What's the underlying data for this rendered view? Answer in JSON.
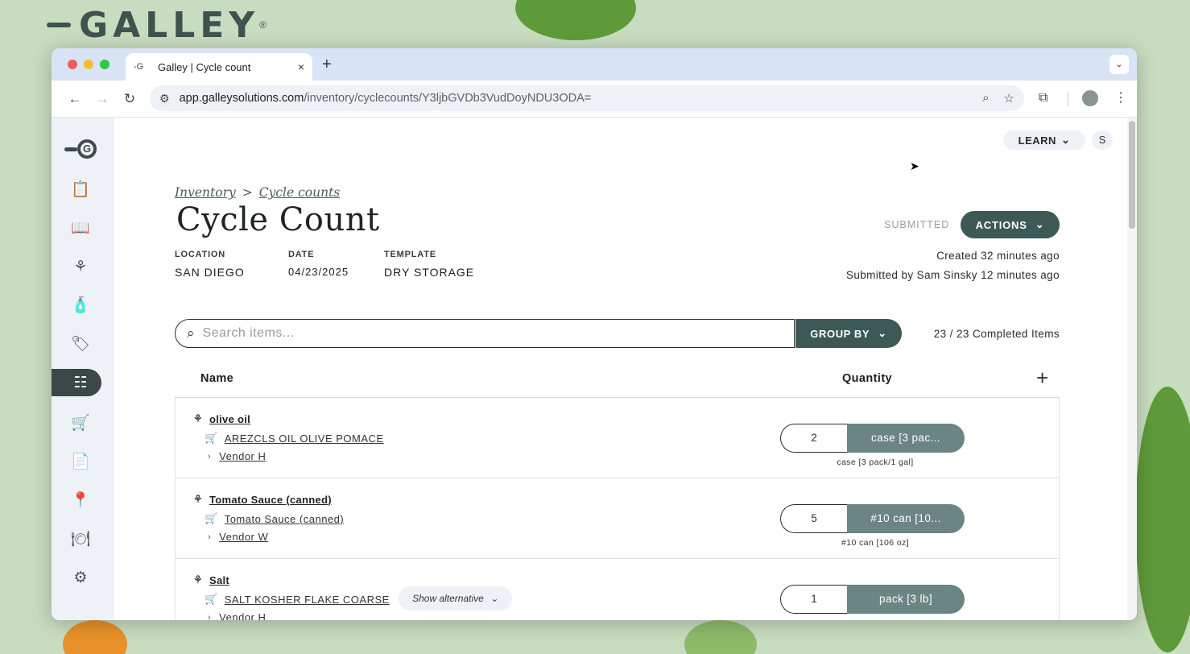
{
  "brand": {
    "name": "GALLEY",
    "registered": "®"
  },
  "browser": {
    "tab_title": "Galley | Cycle count",
    "tab_close": "×",
    "new_tab": "+",
    "tab_menu": "⌄",
    "url_host": "app.galleysolutions.com",
    "url_path": "/inventory/cyclecounts/Y3ljbGVDb3VudDoyNDU3ODA="
  },
  "sidebar": {
    "items": [
      {
        "name": "recipes-nav",
        "icon": "📋"
      },
      {
        "name": "menus-nav",
        "icon": "📖"
      },
      {
        "name": "ingredients-nav",
        "icon": "⚘"
      },
      {
        "name": "packaging-nav",
        "icon": "🧴"
      },
      {
        "name": "tags-nav",
        "icon": "🏷"
      },
      {
        "name": "inventory-nav",
        "icon": "☷",
        "active": true
      },
      {
        "name": "ordering-nav",
        "icon": "🛒"
      },
      {
        "name": "reports-nav",
        "icon": "📄"
      },
      {
        "name": "locations-nav",
        "icon": "📍"
      },
      {
        "name": "service-nav",
        "icon": "🍽"
      },
      {
        "name": "settings-nav",
        "icon": "⚙"
      }
    ]
  },
  "header": {
    "learn_label": "LEARN",
    "user_initial": "S"
  },
  "breadcrumb": {
    "inventory": "Inventory",
    "separator": ">",
    "cycle_counts": "Cycle counts"
  },
  "page": {
    "title": "Cycle Count",
    "status": "SUBMITTED",
    "actions_label": "ACTIONS",
    "location_label": "LOCATION",
    "location_value": "SAN DIEGO",
    "date_label": "DATE",
    "date_value": "04/23/2025",
    "template_label": "TEMPLATE",
    "template_value": "DRY STORAGE",
    "created": "Created  32 minutes ago",
    "submitted": "Submitted by Sam Sinsky  12 minutes ago"
  },
  "search": {
    "placeholder": "Search items..."
  },
  "group_by_label": "GROUP BY",
  "completed": "23 / 23 Completed Items",
  "table": {
    "col_name": "Name",
    "col_quantity": "Quantity",
    "add": "+",
    "rows": [
      {
        "ingredient": "olive oil",
        "product": "AREZCLS OIL OLIVE POMACE",
        "vendor": "Vendor H",
        "quantity": "2",
        "unit": "case [3 pac...",
        "unit_caption": "case [3 pack/1 gal]"
      },
      {
        "ingredient": "Tomato Sauce (canned)",
        "product": "Tomato Sauce (canned)",
        "vendor": "Vendor W",
        "quantity": "5",
        "unit": "#10 can [10...",
        "unit_caption": "#10 can [106 oz]"
      },
      {
        "ingredient": "Salt",
        "product": "SALT KOSHER FLAKE COARSE",
        "vendor": "Vendor H",
        "quantity": "1",
        "unit": "pack [3 lb]",
        "show_alternative": "Show alternative"
      }
    ]
  }
}
